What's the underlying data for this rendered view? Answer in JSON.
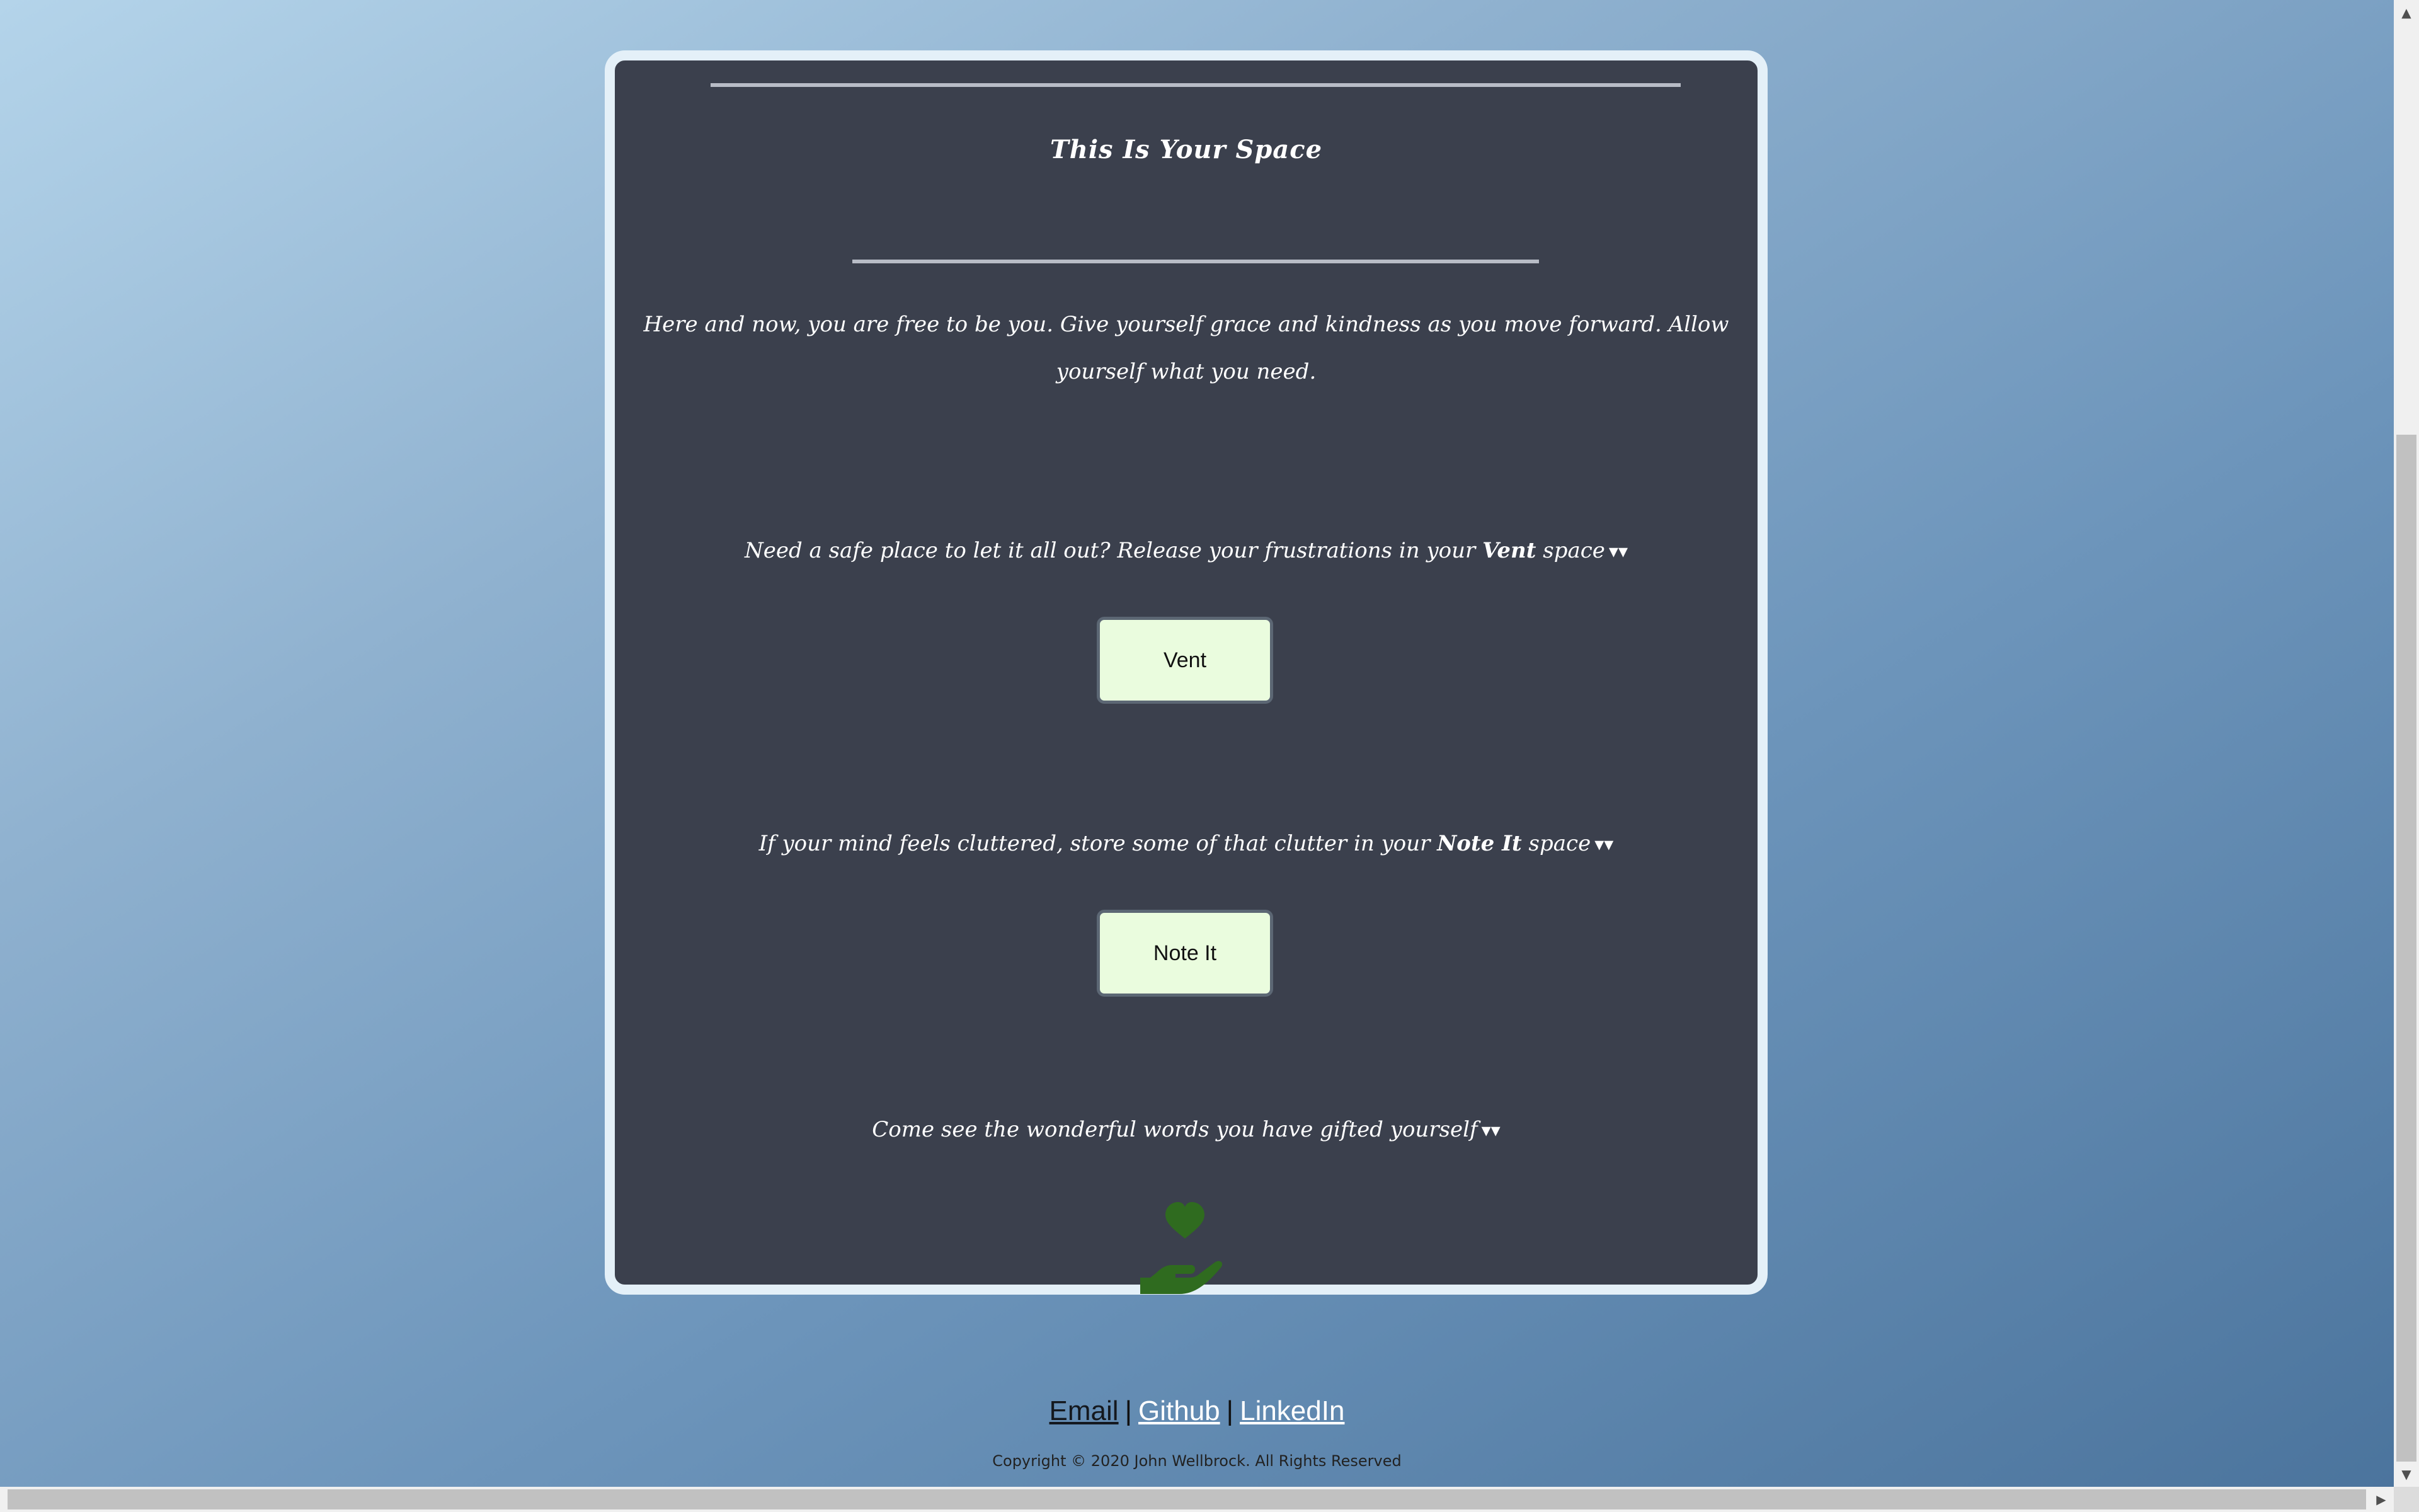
{
  "card": {
    "title": "This Is Your Space",
    "intro": "Here and now, you are free to be you. Give yourself grace and kindness as you move forward. Allow yourself what you need."
  },
  "vent": {
    "prompt_before": "Need a safe place to let it all out? Release your frustrations in your ",
    "prompt_bold": "Vent",
    "prompt_after": " space",
    "button_label": "Vent"
  },
  "note": {
    "prompt_before": "If your mind feels cluttered, store some of that clutter in your ",
    "prompt_bold": "Note It",
    "prompt_after": " space",
    "button_label": "Note It"
  },
  "gift": {
    "prompt": "Come see the wonderful words you have gifted yourself",
    "icon": "hand-holding-heart-icon"
  },
  "footer": {
    "links": [
      "Email",
      "Github",
      "LinkedIn"
    ],
    "separator": "|",
    "copyright": "Copyright © 2020 John Wellbrock. All Rights Reserved"
  },
  "icons": {
    "chevron": "double-chevron-down-icon",
    "chevron_glyph": "»"
  },
  "colors": {
    "card_background": "#3b404d",
    "card_border": "#e4f0f8",
    "button_background": "#eafcde",
    "heart_icon": "#2f6b1f"
  }
}
